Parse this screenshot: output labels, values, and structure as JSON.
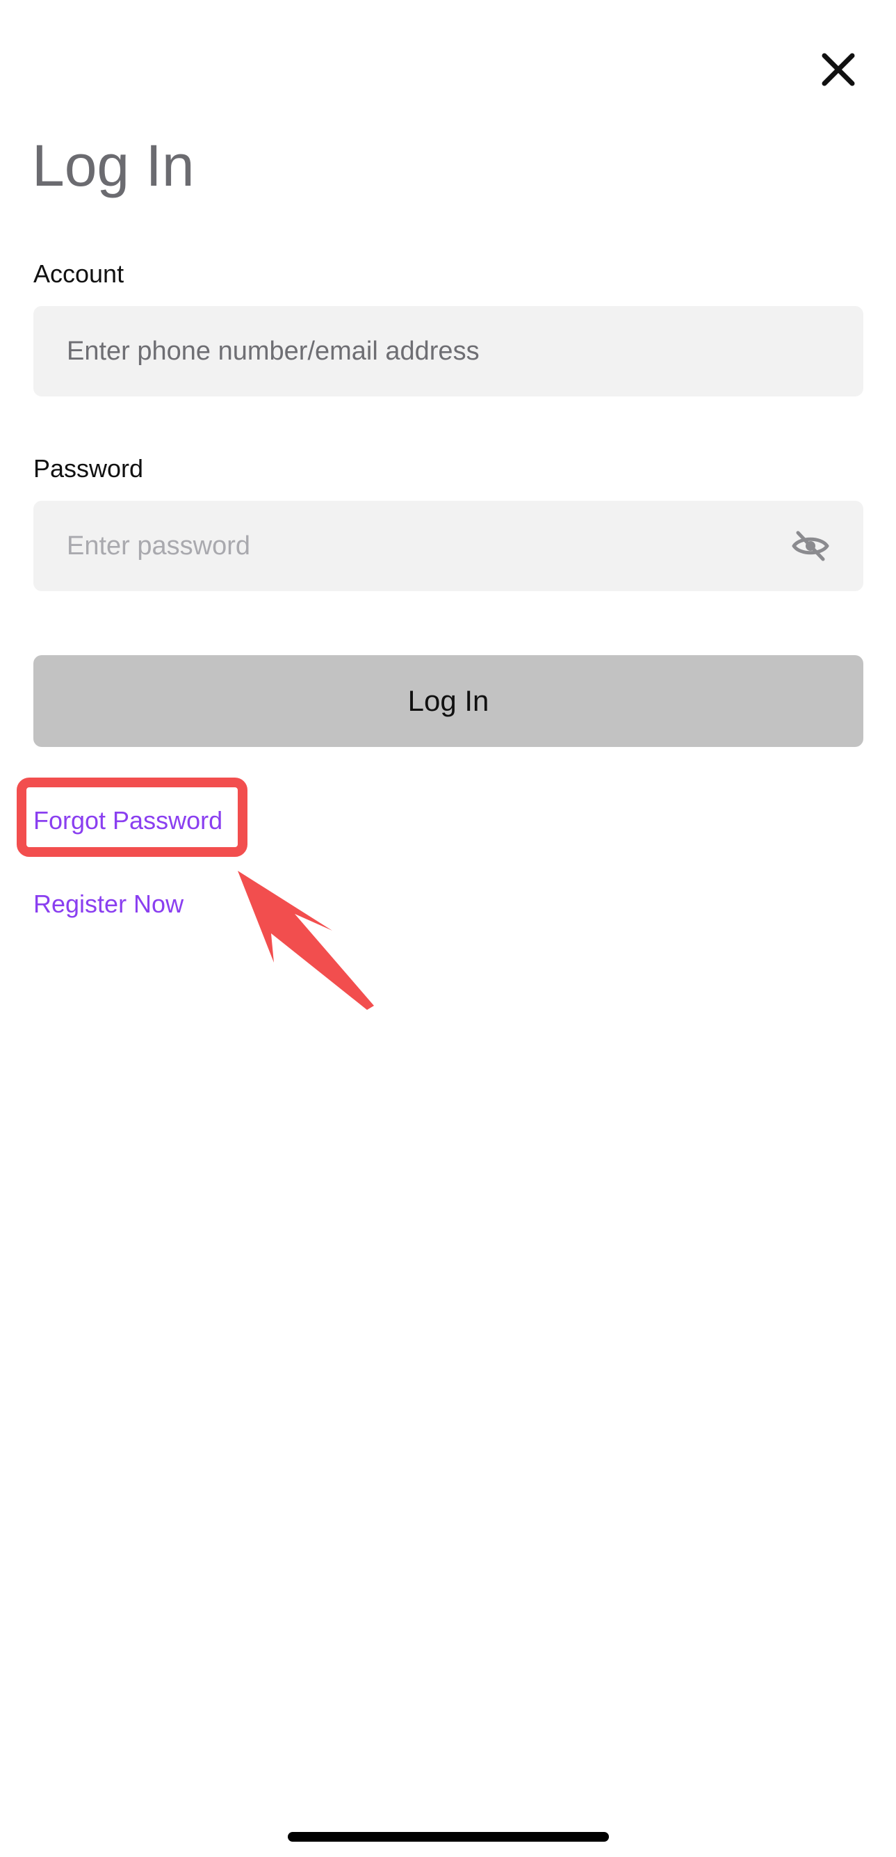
{
  "header": {
    "close_icon": "close-icon",
    "title": "Log In"
  },
  "account": {
    "label": "Account",
    "placeholder": "Enter phone number/email address",
    "value": ""
  },
  "password": {
    "label": "Password",
    "placeholder": "Enter password",
    "value": "",
    "toggle_icon": "eye-slash-icon"
  },
  "login_button": {
    "label": "Log In"
  },
  "links": {
    "forgot_password": "Forgot Password",
    "register_now": "Register Now"
  },
  "annotation": {
    "highlight_target": "Forgot Password",
    "highlight_color": "#f24e4e",
    "arrow_icon": "arrow-icon"
  },
  "colors": {
    "link": "#8a3ff0",
    "button_disabled": "#c2c2c2",
    "input_background": "#f2f2f2",
    "title": "#6b6b70"
  }
}
